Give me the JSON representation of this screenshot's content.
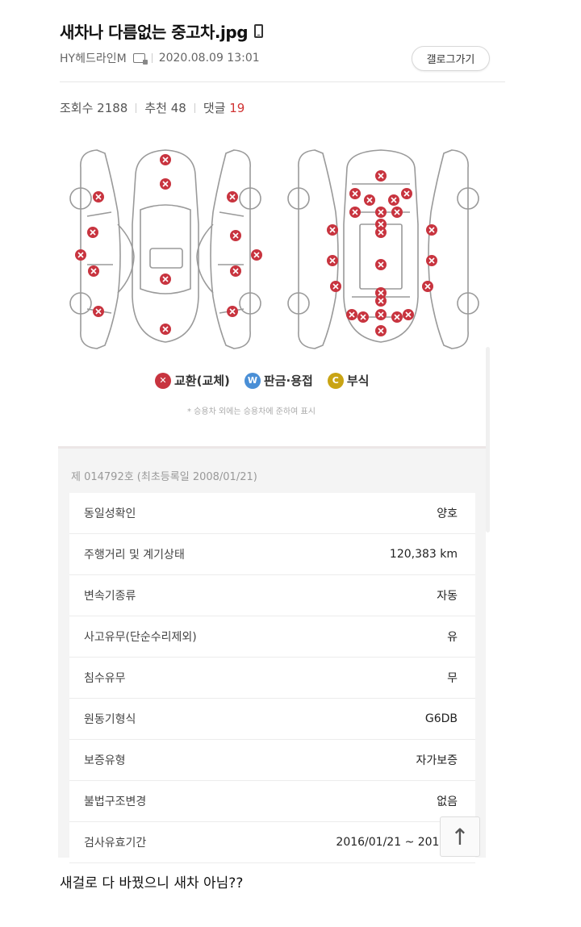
{
  "post": {
    "title": "새차나 다름없는 중고차.jpg",
    "author": "HY헤드라인M",
    "datetime": "2020.08.09 13:01",
    "gallery_button": "갤로그가기",
    "views_label": "조회수 2188",
    "recommend_label": "추천 48",
    "comments_label": "댓글",
    "comments_count": "19"
  },
  "diagram": {
    "legend": [
      {
        "symbol": "✕",
        "label": "교환(교체)",
        "color": "#c8343f"
      },
      {
        "symbol": "W",
        "label": "판금·용접",
        "color": "#4a8fd6"
      },
      {
        "symbol": "C",
        "label": "부식",
        "color": "#c9a414"
      }
    ],
    "note": "* 승용차 외에는 승용차에 준하여 표시",
    "marker_color": "#c8343f"
  },
  "inspection": {
    "registration": "제 014792호 (최초등록일 2008/01/21)",
    "rows": [
      {
        "label": "동일성확인",
        "value": "양호"
      },
      {
        "label": "주행거리 및 계기상태",
        "value": "120,383 km"
      },
      {
        "label": "변속기종류",
        "value": "자동"
      },
      {
        "label": "사고유무(단순수리제외)",
        "value": "유"
      },
      {
        "label": "침수유무",
        "value": "무"
      },
      {
        "label": "원동기형식",
        "value": "G6DB"
      },
      {
        "label": "보증유형",
        "value": "자가보증"
      },
      {
        "label": "불법구조변경",
        "value": "없음"
      },
      {
        "label": "검사유효기간",
        "value": "2016/01/21 ~ 2018/0"
      }
    ],
    "top_button": "↑"
  },
  "caption": "새걸로 다 바꿨으니 새차 아님??"
}
